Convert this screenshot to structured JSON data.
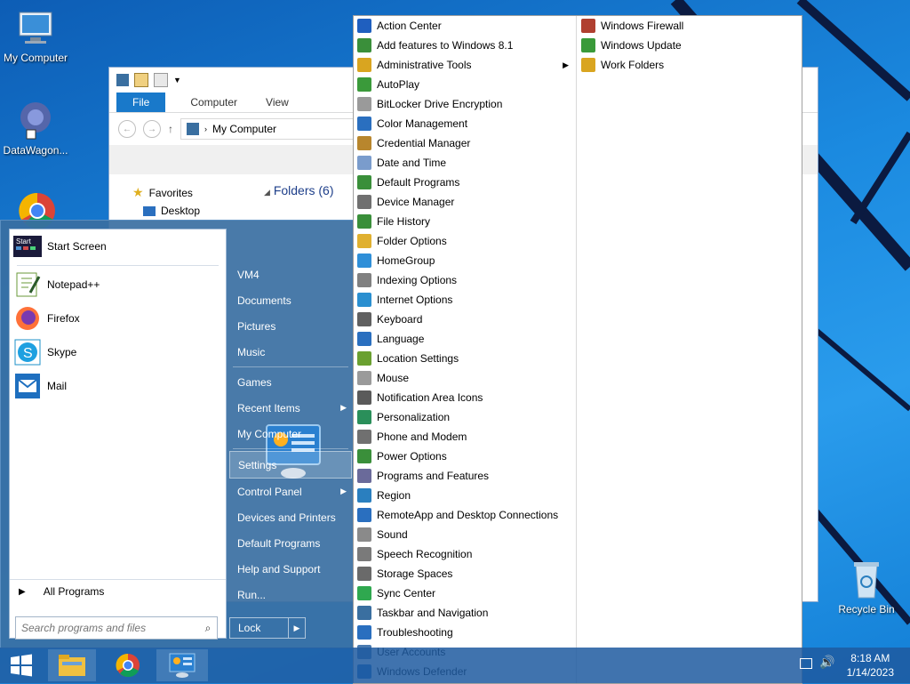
{
  "desktop": {
    "icons": [
      {
        "label": "My Computer"
      },
      {
        "label": "DataWagon..."
      },
      {
        "label": "Recycle Bin"
      }
    ]
  },
  "explorer": {
    "tabs": [
      "File",
      "Computer",
      "View"
    ],
    "address": "My Computer",
    "sidebar_favorites": "Favorites",
    "sidebar_desktop": "Desktop",
    "folders_header": "Folders (6)"
  },
  "start_menu": {
    "pinned": [
      {
        "label": "Start Screen",
        "icon": "start-screen-icon"
      },
      {
        "label": "Notepad++",
        "icon": "notepad-icon"
      },
      {
        "label": "Firefox",
        "icon": "firefox-icon"
      },
      {
        "label": "Skype",
        "icon": "skype-icon"
      },
      {
        "label": "Mail",
        "icon": "mail-icon"
      }
    ],
    "all_programs": "All Programs",
    "search_placeholder": "Search programs and files",
    "right_items": [
      {
        "label": "VM4"
      },
      {
        "label": "Documents"
      },
      {
        "label": "Pictures"
      },
      {
        "label": "Music"
      },
      {
        "label": "Games"
      },
      {
        "label": "Recent Items",
        "arrow": true
      },
      {
        "label": "My Computer"
      },
      {
        "label": "Settings",
        "active": true
      },
      {
        "label": "Control Panel",
        "arrow": true
      },
      {
        "label": "Devices and Printers"
      },
      {
        "label": "Default Programs"
      },
      {
        "label": "Help and Support"
      },
      {
        "label": "Run..."
      }
    ],
    "lock_label": "Lock"
  },
  "control_panel": {
    "col1": [
      {
        "label": "Action Center",
        "color": "#1f5fbf"
      },
      {
        "label": "Add features to Windows 8.1",
        "color": "#3a8f3a"
      },
      {
        "label": "Administrative Tools",
        "color": "#d9a520",
        "arrow": true
      },
      {
        "label": "AutoPlay",
        "color": "#3a9a3a"
      },
      {
        "label": "BitLocker Drive Encryption",
        "color": "#9a9a9a"
      },
      {
        "label": "Color Management",
        "color": "#2a6fbf"
      },
      {
        "label": "Credential Manager",
        "color": "#b8862d"
      },
      {
        "label": "Date and Time",
        "color": "#7a9ccc"
      },
      {
        "label": "Default Programs",
        "color": "#3a8f3a"
      },
      {
        "label": "Device Manager",
        "color": "#707070"
      },
      {
        "label": "File History",
        "color": "#3a8f3a"
      },
      {
        "label": "Folder Options",
        "color": "#e0b030"
      },
      {
        "label": "HomeGroup",
        "color": "#2f8fd8"
      },
      {
        "label": "Indexing Options",
        "color": "#808080"
      },
      {
        "label": "Internet Options",
        "color": "#2a8fd0"
      },
      {
        "label": "Keyboard",
        "color": "#606060"
      },
      {
        "label": "Language",
        "color": "#2a6fbf"
      },
      {
        "label": "Location Settings",
        "color": "#6aa030"
      },
      {
        "label": "Mouse",
        "color": "#9a9a9a"
      },
      {
        "label": "Notification Area Icons",
        "color": "#5a5a5a"
      },
      {
        "label": "Personalization",
        "color": "#2a8f5a"
      },
      {
        "label": "Phone and Modem",
        "color": "#707070"
      },
      {
        "label": "Power Options",
        "color": "#3a8f3a"
      },
      {
        "label": "Programs and Features",
        "color": "#6a6a9a"
      },
      {
        "label": "Region",
        "color": "#2a7fbf"
      },
      {
        "label": "RemoteApp and Desktop Connections",
        "color": "#2a6fbf"
      },
      {
        "label": "Sound",
        "color": "#8a8a8a"
      },
      {
        "label": "Speech Recognition",
        "color": "#7a7a7a"
      },
      {
        "label": "Storage Spaces",
        "color": "#6a6a6a"
      },
      {
        "label": "Sync Center",
        "color": "#2fa84f"
      },
      {
        "label": "Taskbar and Navigation",
        "color": "#3a6fa0"
      },
      {
        "label": "Troubleshooting",
        "color": "#2a6fbf"
      },
      {
        "label": "User Accounts",
        "color": "#4a7ab0"
      },
      {
        "label": "Windows Defender",
        "color": "#1f6fbf"
      }
    ],
    "col2": [
      {
        "label": "Windows Firewall",
        "color": "#b04030"
      },
      {
        "label": "Windows Update",
        "color": "#3a9a3a"
      },
      {
        "label": "Work Folders",
        "color": "#d9a520"
      }
    ]
  },
  "taskbar": {
    "apps": [
      {
        "icon": "start-icon"
      },
      {
        "icon": "file-explorer-icon"
      },
      {
        "icon": "chrome-icon"
      },
      {
        "icon": "control-panel-icon"
      }
    ],
    "time": "8:18 AM",
    "date": "1/14/2023"
  }
}
